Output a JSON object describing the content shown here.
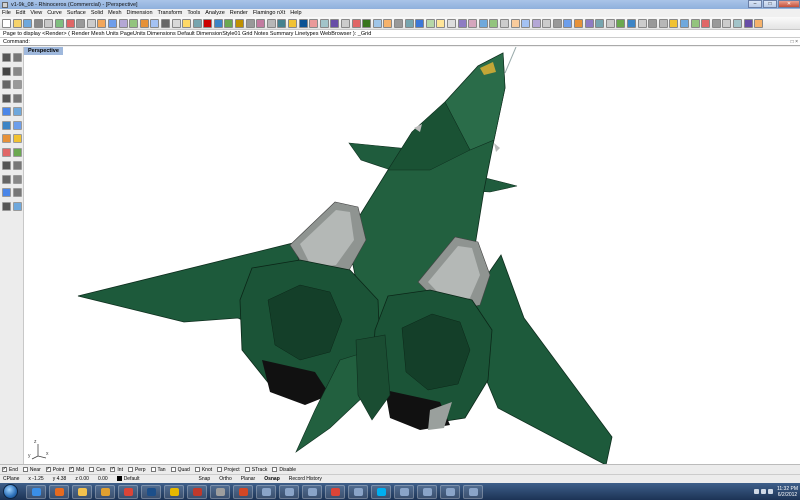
{
  "window": {
    "title": "v1-9k_08 - Rhinoceros (Commercial) - [Perspective]",
    "controls": [
      "–",
      "□",
      "✕"
    ]
  },
  "menu": [
    "File",
    "Edit",
    "View",
    "Curve",
    "Surface",
    "Solid",
    "Mesh",
    "Dimension",
    "Transform",
    "Tools",
    "Analyze",
    "Render",
    "Flamingo nXt",
    "Help"
  ],
  "command_history": "Page to display <Render> ( Render  Mesh  Units  PageUnits  Dimensions  Default  DimensionStyle01  Grid  Notes  Summary  Linetypes  WebBrowser ): _Grid",
  "command_prompt": "Command:",
  "command_controls": "□ ×",
  "viewport": {
    "tab": "Perspective",
    "background": "#ffffff",
    "model_color": "#1f5a3c",
    "axis_labels": [
      "z",
      "x",
      "y"
    ]
  },
  "osnaps": [
    {
      "label": "End",
      "checked": true
    },
    {
      "label": "Near",
      "checked": false
    },
    {
      "label": "Point",
      "checked": true
    },
    {
      "label": "Mid",
      "checked": true
    },
    {
      "label": "Cen",
      "checked": false
    },
    {
      "label": "Int",
      "checked": true
    },
    {
      "label": "Perp",
      "checked": false
    },
    {
      "label": "Tan",
      "checked": false
    },
    {
      "label": "Quad",
      "checked": false
    },
    {
      "label": "Knot",
      "checked": false
    },
    {
      "label": "Project",
      "checked": false
    },
    {
      "label": "STrack",
      "checked": false
    },
    {
      "label": "Disable",
      "checked": false
    }
  ],
  "status": {
    "cplane": "CPlane",
    "x": "x -1.25",
    "y": "y 4.38",
    "z": "z 0.00",
    "extra": "0.00",
    "layer": "Default",
    "snap": "Snap",
    "ortho": "Ortho",
    "planar": "Planar",
    "osnap": "Osnap",
    "record": "Record History"
  },
  "taskbar": {
    "apps": [
      "ie-icon",
      "firefox-icon",
      "explorer-icon",
      "media-icon",
      "chrome-icon",
      "photoshop-icon",
      "folder-icon",
      "sketchup-icon",
      "rhino-icon",
      "powerpoint-icon",
      "app-icon",
      "app-icon",
      "app-icon",
      "chrome-icon",
      "app-icon",
      "skype-icon",
      "app-icon",
      "app-icon",
      "app-icon",
      "app-icon"
    ],
    "time": "11:32 PM",
    "date": "6/2/2012"
  }
}
